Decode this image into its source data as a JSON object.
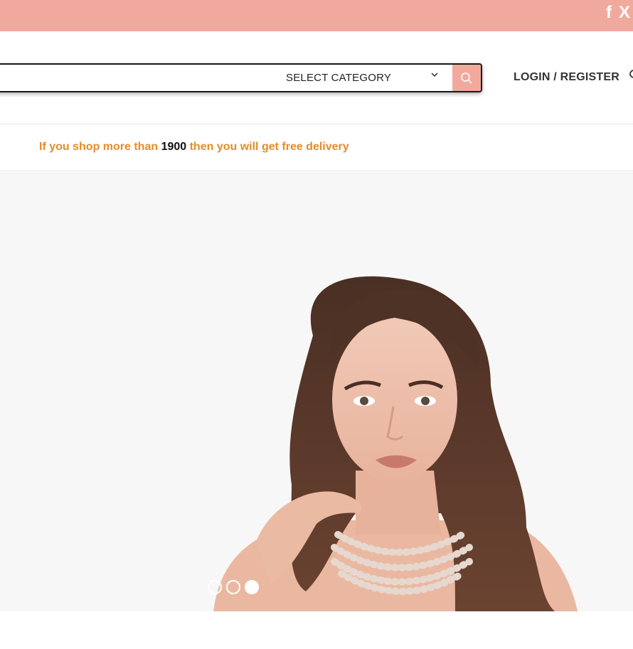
{
  "topbar": {
    "color": "#f2a99d",
    "social": [
      {
        "name": "facebook-icon",
        "glyph": "f"
      },
      {
        "name": "x-icon",
        "glyph": "X"
      }
    ]
  },
  "header": {
    "search": {
      "placeholder": "",
      "category_label": "SELECT CATEGORY"
    },
    "login_label": "LOGIN / REGISTER"
  },
  "promo": {
    "before": "If you shop more than ",
    "amount": "1900",
    "after": " then you will get free delivery"
  },
  "hero": {
    "slides_count": 3,
    "active_slide": 3
  },
  "colors": {
    "accent": "#f2a99d",
    "promo_text": "#e38d2a"
  }
}
